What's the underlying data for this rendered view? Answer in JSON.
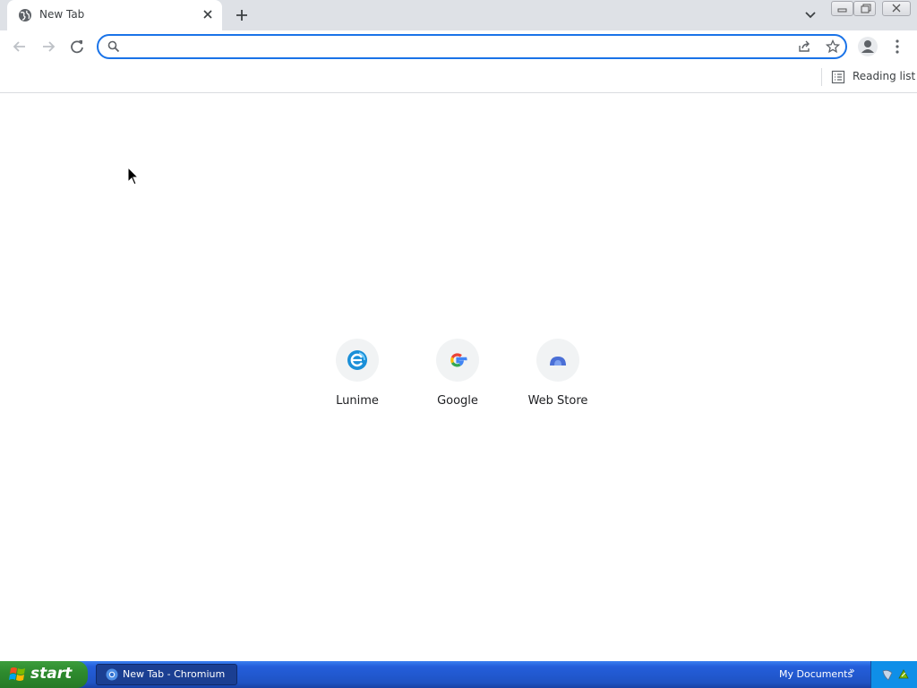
{
  "tab": {
    "title": "New Tab",
    "favicon": "globe-icon",
    "close": "close-icon"
  },
  "tabstrip": {
    "new_tab": "plus-icon",
    "tab_search": "chevron-down-icon"
  },
  "window_controls": [
    "minimize-icon",
    "restore-icon",
    "close-icon"
  ],
  "toolbar": {
    "back": "arrow-left-icon",
    "forward": "arrow-right-icon",
    "reload": "reload-icon",
    "omnibox": {
      "value": "",
      "placeholder": ""
    },
    "share": "share-icon",
    "bookmark": "star-icon",
    "profile": "person-icon",
    "menu": "kebab-menu-icon"
  },
  "bookmarks_bar": {
    "reading_list_label": "Reading list"
  },
  "shortcuts": [
    {
      "label": "Lunime",
      "icon": "lunime-icon"
    },
    {
      "label": "Google",
      "icon": "google-icon"
    },
    {
      "label": "Web Store",
      "icon": "webstore-icon"
    }
  ],
  "taskbar": {
    "start_label": "start",
    "task_label": "New Tab - Chromium",
    "toolbar_label": "My Documents",
    "toolbar_arrow": "»"
  },
  "colors": {
    "accent": "#1a73e8",
    "tabstrip": "#dee1e6",
    "taskbar": "#245edb",
    "start": "#2e8b2e"
  }
}
